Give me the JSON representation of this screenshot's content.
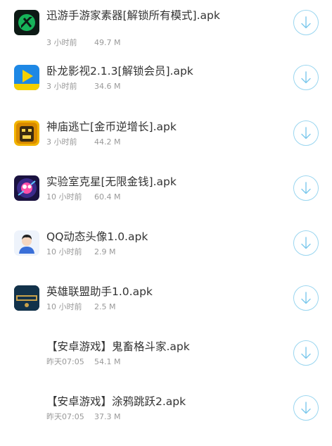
{
  "files": [
    {
      "name": "迅游手游家素器[解锁所有模式].apk",
      "time": "3 小时前",
      "size": "49.7 M",
      "icon": "xunyou-app-icon"
    },
    {
      "name": "卧龙影视2.1.3[解锁会员].apk",
      "time": "3 小时前",
      "size": "34.6 M",
      "icon": "wolong-video-app-icon"
    },
    {
      "name": "神庙逃亡[金币逆增长].apk",
      "time": "3 小时前",
      "size": "44.2 M",
      "icon": "temple-run-app-icon"
    },
    {
      "name": "实验室克星[无限金钱].apk",
      "time": "10 小时前",
      "size": "60.4 M",
      "icon": "lab-game-app-icon"
    },
    {
      "name": "QQ动态头像1.0.apk",
      "time": "10 小时前",
      "size": "2.9 M",
      "icon": "avatar-app-icon"
    },
    {
      "name": "英雄联盟助手1.0.apk",
      "time": "10 小时前",
      "size": "2.5 M",
      "icon": "lol-helper-app-icon"
    },
    {
      "name": "【安卓游戏】鬼畜格斗家.apk",
      "time": "昨天07:05",
      "size": "54.1 M",
      "icon": ""
    },
    {
      "name": "【安卓游戏】涂鸦跳跃2.apk",
      "time": "昨天07:05",
      "size": "37.3 M",
      "icon": ""
    }
  ],
  "download_icon": "download-arrow-icon",
  "colors": {
    "download_ring": "#9ad6f0",
    "download_arrow": "#7cc8ec",
    "title": "#333333",
    "meta": "#999999"
  }
}
